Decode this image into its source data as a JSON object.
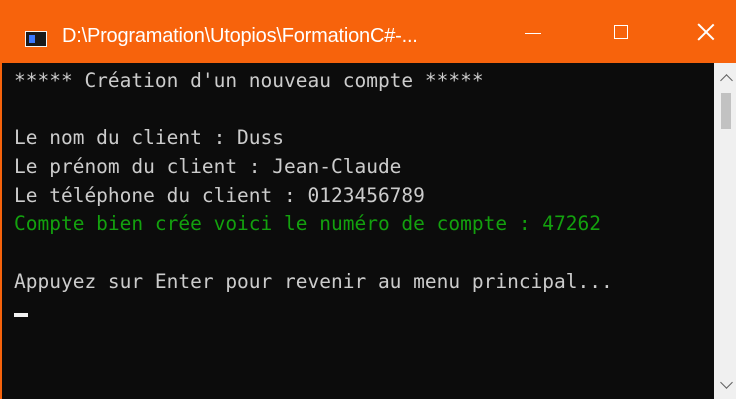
{
  "window": {
    "title": "D:\\Programation\\Utopios\\FormationC#-...",
    "accent_color": "#f7630c",
    "icon": "console-app-icon",
    "controls": {
      "minimize": "minimize-icon",
      "maximize": "maximize-icon",
      "close": "close-icon"
    }
  },
  "console": {
    "background_color": "#0c0c0c",
    "text_color": "#cccccc",
    "success_color": "#13a10e",
    "lines": [
      "***** Création d'un nouveau compte *****",
      "",
      "Le nom du client : Duss",
      "Le prénom du client : Jean-Claude",
      "Le téléphone du client : 0123456789",
      "Compte bien crée voici le numéro de compte : 47262",
      "",
      "Appuyez sur Enter pour revenir au menu principal..."
    ]
  },
  "scrollbar": {
    "up_icon": "chevron-up-icon",
    "down_icon": "chevron-down-icon"
  }
}
